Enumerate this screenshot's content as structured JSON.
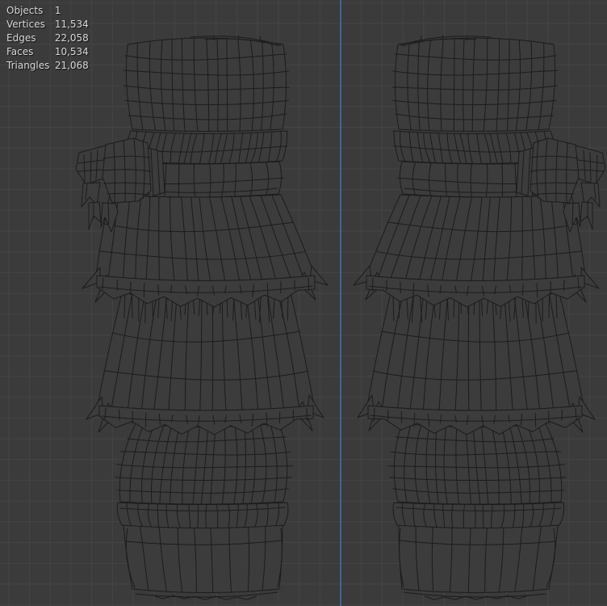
{
  "viewport": {
    "name": "3d-viewport-wireframe",
    "colors": {
      "background": "#3b3b3b",
      "grid": "#454545",
      "axis_z": "#4577b5",
      "wire": "#1c1c1c",
      "face": "#3c3c3c",
      "stats_text": "#d8d8d8"
    },
    "stats": {
      "rows": [
        {
          "label": "Objects",
          "value": "1"
        },
        {
          "label": "Vertices",
          "value": "11,534"
        },
        {
          "label": "Edges",
          "value": "22,058"
        },
        {
          "label": "Faces",
          "value": "10,534"
        },
        {
          "label": "Triangles",
          "value": "21,068"
        }
      ]
    }
  }
}
